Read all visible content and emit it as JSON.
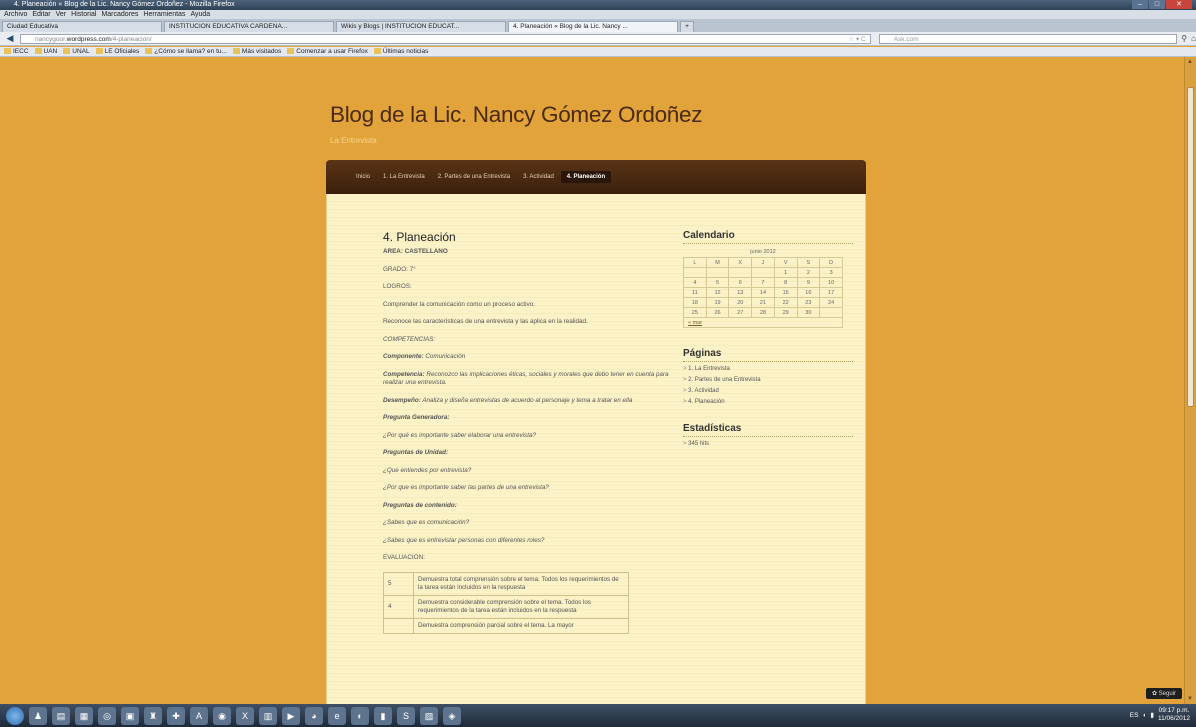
{
  "window": {
    "title": "4. Planeación « Blog de la Lic. Nancy Gómez Ordoñez - Mozilla Firefox"
  },
  "menu_bar": [
    "Archivo",
    "Editar",
    "Ver",
    "Historial",
    "Marcadores",
    "Herramientas",
    "Ayuda"
  ],
  "tabs": [
    {
      "label": "Ciudad Educativa",
      "active": false
    },
    {
      "label": "INSTITUCION EDUCATIVA CARDENA...",
      "active": false
    },
    {
      "label": "Wikis y Blogs | INSTITUCION EDUCAT...",
      "active": false
    },
    {
      "label": "4. Planeación « Blog de la Lic. Nancy ...",
      "active": true
    }
  ],
  "address": {
    "prefix": "nancygoor.",
    "domain": "wordpress.com",
    "path": "/4-planeacion/"
  },
  "search": {
    "placeholder": "Ask.com"
  },
  "bookmarks": [
    "IECC",
    "UAN",
    "UNAL",
    "LE Oficiales",
    "¿Cómo se llama? en tu...",
    "Más visitados",
    "Comenzar a usar Firefox",
    "Últimas noticias"
  ],
  "blog": {
    "title": "Blog de la Lic. Nancy Gómez Ordoñez",
    "tagline": "La Entrevista",
    "nav": [
      {
        "label": "Inicio",
        "active": false
      },
      {
        "label": "1. La Entrevista",
        "active": false
      },
      {
        "label": "2. Partes de una Entrevista",
        "active": false
      },
      {
        "label": "3. Actividad",
        "active": false
      },
      {
        "label": "4. Planeación",
        "active": true
      }
    ]
  },
  "post": {
    "title": "4. Planeación",
    "area": "AREA: CASTELLANO",
    "grado": "GRADO: 7°",
    "logros": "LOGROS:",
    "logro1": "Comprender la comunicación como un proceso activo.",
    "logro2": "Reconoce las características de una entrevista y las aplica en la realidad.",
    "competencias": "COMPETENCIAS:",
    "componente_label": "Componente:",
    "componente_val": "Comunicación",
    "competencia_label": "Competencia:",
    "competencia_val": "Reconozco las implicaciones éticas, sociales y morales que debo tener en cuenta para realizar una entrevista.",
    "desempeno_label": "Desempeño:",
    "desempeno_val": "Analiza y diseña entrevistas de acuerdo al personaje y tema a tratar en ella",
    "pregunta_gen": "Pregunta Generadora:",
    "pregunta_gen_q": "¿Por qué es importante saber elaborar una entrevista?",
    "preguntas_unidad": "Preguntas de Unidad:",
    "pu_q1": "¿Que entiendes por entrevista?",
    "pu_q2": "¿Por que es importante saber las partes de una entrevista?",
    "preguntas_contenido": "Preguntas de contenido:",
    "pc_q1": "¿Sabes que es comunicación?",
    "pc_q2": "¿Sabes que es entrevistar personas con diferentes roles?",
    "evaluacion": "EVALUACION:",
    "eval_rows": [
      {
        "n": "5",
        "text": "Demuestra total comprensión sobre el tema. Todos los requerimientos de la tarea están incluidos en la respuesta"
      },
      {
        "n": "4",
        "text": "Demuestra considerable comprensión sobre el tema. Todos los requerimientos de la tarea están incluidos en la respuesta"
      },
      {
        "n": "",
        "text": "Demuestra comprensión parcial sobre el tema. La mayor"
      }
    ]
  },
  "sidebar": {
    "calendar_title": "Calendario",
    "calendar_caption": "junio 2012",
    "weekdays": [
      "L",
      "M",
      "X",
      "J",
      "V",
      "S",
      "D"
    ],
    "weeks": [
      [
        "",
        "",
        "",
        "",
        "1",
        "2",
        "3"
      ],
      [
        "4",
        "5",
        "6",
        "7",
        "8",
        "9",
        "10"
      ],
      [
        "11",
        "12",
        "13",
        "14",
        "15",
        "16",
        "17"
      ],
      [
        "18",
        "19",
        "20",
        "21",
        "22",
        "23",
        "24"
      ],
      [
        "25",
        "26",
        "27",
        "28",
        "29",
        "30",
        ""
      ]
    ],
    "prev_link": "« mar",
    "paginas_title": "Páginas",
    "paginas": [
      "1. La Entrevista",
      "2. Partes de una Entrevista",
      "3. Actividad",
      "4. Planeación"
    ],
    "stats_title": "Estadísticas",
    "stats": [
      "345 hits"
    ]
  },
  "follow": "✿ Seguir",
  "tray": {
    "lang": "ES",
    "time": "09:17 p.m.",
    "date": "11/06/2012"
  }
}
